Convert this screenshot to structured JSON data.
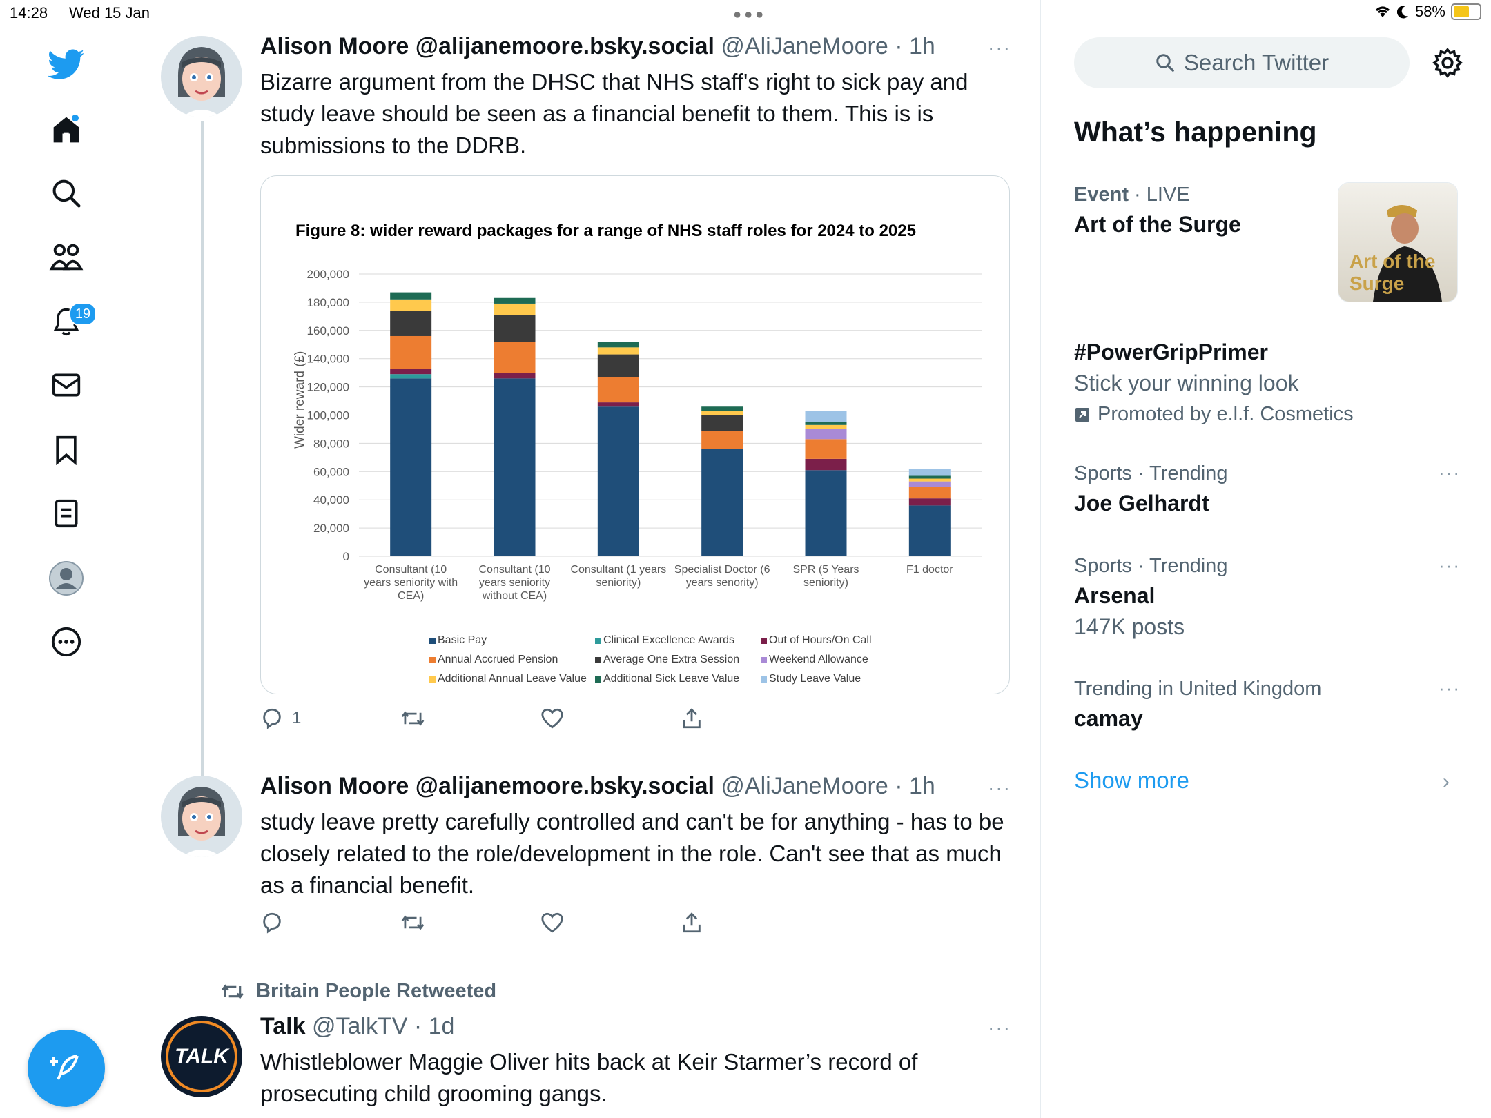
{
  "status": {
    "time": "14:28",
    "date": "Wed 15 Jan",
    "battery": "58%"
  },
  "nav": {
    "notifications_count": "19"
  },
  "tweets": [
    {
      "name": "Alison Moore @alijanemoore.bsky.social",
      "handle": "@AliJaneMoore",
      "time": "· 1h",
      "text": "Bizarre argument from the DHSC that NHS staff's right to sick pay and study leave should be seen as a financial benefit to them. This is is submissions to the DDRB.",
      "replies": "1",
      "more": "···"
    },
    {
      "name": "Alison Moore @alijanemoore.bsky.social",
      "handle": "@AliJaneMoore",
      "time": "· 1h",
      "text": "study leave pretty carefully controlled and can't be for anything - has to be closely related to the role/development in the role. Can't see that as much as a financial benefit.",
      "replies": "",
      "more": "···"
    },
    {
      "retweeted_by": "Britain People Retweeted",
      "name": "Talk",
      "handle": "@TalkTV",
      "time": "· 1d",
      "text": "Whistleblower Maggie Oliver hits back at Keir Starmer’s record of prosecuting child grooming gangs.",
      "avatar_text": "TALK",
      "more": "···"
    }
  ],
  "chart_data": {
    "type": "bar",
    "stacked": true,
    "title": "Figure 8: wider reward packages for a range of NHS staff roles for 2024 to 2025",
    "ylabel": "Wider reward (£)",
    "ylim": [
      0,
      200000
    ],
    "yticks": [
      "0",
      "20,000",
      "40,000",
      "60,000",
      "80,000",
      "100,000",
      "120,000",
      "140,000",
      "160,000",
      "180,000",
      "200,000"
    ],
    "categories": [
      [
        "Consultant (10",
        "years seniority with",
        "CEA)"
      ],
      [
        "Consultant (10",
        "years seniority",
        "without CEA)"
      ],
      [
        "Consultant (1 years",
        "seniority)"
      ],
      [
        "Specialist Doctor (6",
        "years senority)"
      ],
      [
        "SPR (5 Years",
        "seniority)"
      ],
      [
        "F1 doctor"
      ]
    ],
    "series": [
      {
        "name": "Basic Pay",
        "color": "#1f4e79",
        "values": [
          126000,
          126000,
          106000,
          76000,
          61000,
          36000
        ]
      },
      {
        "name": "Clinical Excellence Awards",
        "color": "#2e9b9b",
        "values": [
          3000,
          0,
          0,
          0,
          0,
          0
        ]
      },
      {
        "name": "Out of Hours/On Call",
        "color": "#7b1f4a",
        "values": [
          4000,
          4000,
          3000,
          0,
          8000,
          5000
        ]
      },
      {
        "name": "Annual Accrued Pension",
        "color": "#ed7d31",
        "values": [
          23000,
          22000,
          18000,
          13000,
          14000,
          8000
        ]
      },
      {
        "name": "Average One Extra Session",
        "color": "#3a3a3a",
        "values": [
          18000,
          19000,
          16000,
          11000,
          0,
          0
        ]
      },
      {
        "name": "Weekend Allowance",
        "color": "#a98ad6",
        "values": [
          0,
          0,
          0,
          0,
          7000,
          4000
        ]
      },
      {
        "name": "Additional Annual Leave Value",
        "color": "#ffc94d",
        "values": [
          8000,
          8000,
          5000,
          3000,
          3000,
          2000
        ]
      },
      {
        "name": "Additional Sick Leave Value",
        "color": "#1e6b54",
        "values": [
          5000,
          4000,
          4000,
          3000,
          2000,
          2000
        ]
      },
      {
        "name": "Study Leave Value",
        "color": "#9dc3e6",
        "values": [
          0,
          0,
          0,
          0,
          8000,
          5000
        ]
      }
    ],
    "legend_placement": "bottom",
    "grid": true
  },
  "sidebar": {
    "search_placeholder": "Search Twitter",
    "heading": "What’s happening",
    "trends": [
      {
        "meta": "Event",
        "meta2": "· LIVE",
        "title": "Art of the Surge",
        "image_text": "Art of the Surge"
      },
      {
        "meta": "",
        "title": "#PowerGripPrimer",
        "sub": "Stick your winning look",
        "promo": "Promoted by e.l.f. Cosmetics"
      },
      {
        "meta": "Sports · Trending",
        "title": "Joe Gelhardt",
        "more": "···"
      },
      {
        "meta": "Sports · Trending",
        "title": "Arsenal",
        "sub": "147K posts",
        "more": "···"
      },
      {
        "meta": "Trending in United Kingdom",
        "title": "camay",
        "more": "···"
      }
    ],
    "show_more": "Show more"
  }
}
